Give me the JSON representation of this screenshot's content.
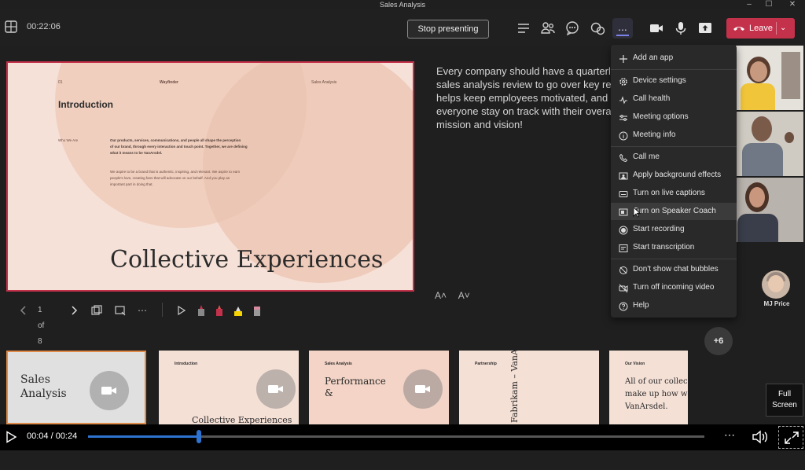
{
  "window": {
    "title": "Sales Analysis",
    "controls": [
      "–",
      "☐",
      "✕"
    ]
  },
  "toolbar": {
    "timer": "00:22:06",
    "stop_presenting": "Stop presenting",
    "more_label": "...",
    "leave_label": "Leave"
  },
  "slide": {
    "header_left": "01",
    "header_mid": "Wayfinder",
    "header_right": "Sales Analysis",
    "heading": "Introduction",
    "side_label": "Who We Are",
    "body_1": "Our products, services, communications, and people all shape the perception",
    "body_2": "of our brand, through every interaction and touch point. Together, we are defining",
    "body_3": "what it means to be VanArsdel.",
    "body_4": "We aspire to be a brand that is authentic, inspiring, and relevant. We aspire to earn",
    "body_5": "people's love, creating fans that will advocate on our behalf. And you play an",
    "body_6": "important part in doing that.",
    "big_title": "Collective Experiences"
  },
  "notes": {
    "lines": [
      "Every company should have a quarterly",
      "sales analysis review to go over key res",
      "helps keep employees motivated, and",
      "everyone stay on track with their overa",
      "mission and vision!"
    ],
    "font_up": "A˄",
    "font_down": "A˅"
  },
  "slide_controls": {
    "page": "1 of 8"
  },
  "thumbnails": [
    {
      "title": "Sales Analysis"
    },
    {
      "header": "Introduction",
      "title": "Collective Experiences"
    },
    {
      "header": "Sales Analysis",
      "title": "Performance &"
    },
    {
      "header": "Partnership",
      "title": "Fabrikam – VanArsdel"
    },
    {
      "header": "Our Vision",
      "title": "All of our collective make up how we c as VanArsdel."
    }
  ],
  "menu": {
    "items": [
      {
        "label": "Add an app",
        "icon": "plus-icon"
      },
      {
        "label": "Device settings",
        "icon": "gear-icon"
      },
      {
        "label": "Call health",
        "icon": "pulse-icon"
      },
      {
        "label": "Meeting options",
        "icon": "sliders-icon"
      },
      {
        "label": "Meeting info",
        "icon": "info-icon"
      },
      {
        "label": "Call me",
        "icon": "phone-icon"
      },
      {
        "label": "Apply background effects",
        "icon": "background-icon"
      },
      {
        "label": "Turn on live captions",
        "icon": "captions-icon"
      },
      {
        "label": "Turn on Speaker Coach",
        "icon": "speaker-coach-icon"
      },
      {
        "label": "Start recording",
        "icon": "record-icon"
      },
      {
        "label": "Start transcription",
        "icon": "transcript-icon"
      },
      {
        "label": "Don't show chat bubbles",
        "icon": "chat-off-icon"
      },
      {
        "label": "Turn off incoming video",
        "icon": "video-off-icon"
      },
      {
        "label": "Help",
        "icon": "help-icon"
      }
    ]
  },
  "roster": {
    "name": "MJ Price",
    "overflow": "+6"
  },
  "tooltip": {
    "line1": "Full",
    "line2": "Screen"
  },
  "player": {
    "time": "00:04 / 00:24",
    "progress": 0.18,
    "more": "⋯"
  },
  "colors": {
    "leave": "#c4314b",
    "accent": "#7b83eb",
    "progress": "#2e73d0"
  }
}
